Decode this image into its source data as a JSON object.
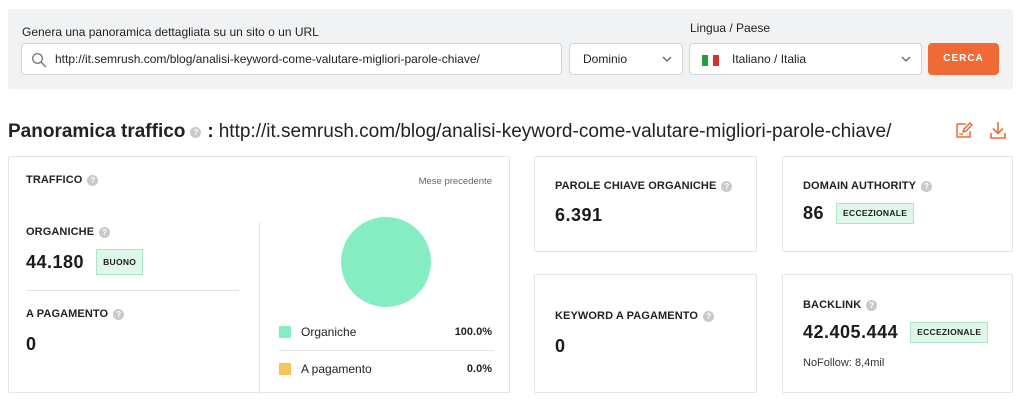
{
  "search": {
    "url_label": "Genera una panoramica dettagliata su un sito o un URL",
    "url_value": "http://it.semrush.com/blog/analisi-keyword-come-valutare-migliori-parole-chiave/",
    "scope_value": "Dominio",
    "lang_label": "Lingua / Paese",
    "lang_value": "Italiano / Italia",
    "button_label": "CERCA",
    "accent_color": "#f06a35"
  },
  "header": {
    "title": "Panoramica traffico",
    "colon": ":",
    "url": "http://it.semrush.com/blog/analisi-keyword-come-valutare-migliori-parole-chiave/"
  },
  "traffic": {
    "title": "TRAFFICO",
    "period": "Mese precedente",
    "organic_label": "ORGANICHE",
    "organic_value": "44.180",
    "organic_badge": "BUONO",
    "paid_label": "A PAGAMENTO",
    "paid_value": "0",
    "legend": [
      {
        "label": "Organiche",
        "pct": "100.0%",
        "color": "#86ecc2"
      },
      {
        "label": "A pagamento",
        "pct": "0.0%",
        "color": "#f7c45a"
      }
    ]
  },
  "chart_data": {
    "type": "pie",
    "categories": [
      "Organiche",
      "A pagamento"
    ],
    "values": [
      100.0,
      0.0
    ],
    "colors": [
      "#86ecc2",
      "#f7c45a"
    ]
  },
  "organic_keywords": {
    "label": "PAROLE CHIAVE ORGANICHE",
    "value": "6.391"
  },
  "domain_authority": {
    "label": "DOMAIN AUTHORITY",
    "value": "86",
    "badge": "ECCEZIONALE"
  },
  "paid_keywords": {
    "label": "KEYWORD A PAGAMENTO",
    "value": "0"
  },
  "backlinks": {
    "label": "BACKLINK",
    "value": "42.405.444",
    "badge": "ECCEZIONALE",
    "nofollow": "NoFollow: 8,4mil"
  },
  "help_glyph": "?"
}
